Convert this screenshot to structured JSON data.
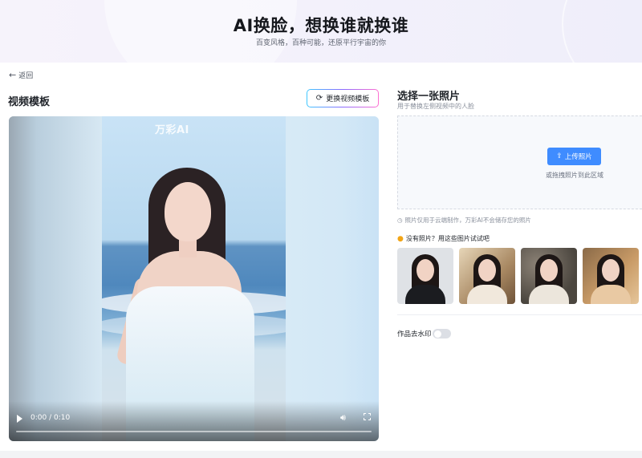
{
  "header": {
    "title": "AI换脸，想换谁就换谁",
    "subtitle": "百变风格，百种可能，还原平行宇宙的你"
  },
  "nav": {
    "back_label": "返回"
  },
  "left": {
    "title": "视频模板",
    "switch_button": "更换视频模板",
    "video": {
      "watermark": "万彩AI",
      "time": "0:00 / 0:10",
      "progress": 0
    }
  },
  "right": {
    "title": "选择一张照片",
    "subtitle": "用于替换左侧视频中的人脸",
    "upload_button": "上传照片",
    "drop_hint": "或拖拽照片到此区域",
    "privacy_note": "照片仅用于云端制作，万彩AI不会储存您的照片",
    "try_prompt": "没有照片？用这些图片试试吧",
    "samples": [
      {
        "name": "sample-suit",
        "bg": "#dfe2e6",
        "body": "#1b1c20"
      },
      {
        "name": "sample-hanfu-sun",
        "bg": "#a88862",
        "body": "#f1e8dc"
      },
      {
        "name": "sample-flowers",
        "bg": "#4b463f",
        "body": "#ece6dc"
      },
      {
        "name": "sample-warm",
        "bg": "#c99b67",
        "body": "#e9c9a3"
      }
    ],
    "watermark_option": {
      "label": "作品去水印",
      "enabled": false
    }
  },
  "colors": {
    "accent": "#3f8cff",
    "pin": "#f2a516"
  }
}
